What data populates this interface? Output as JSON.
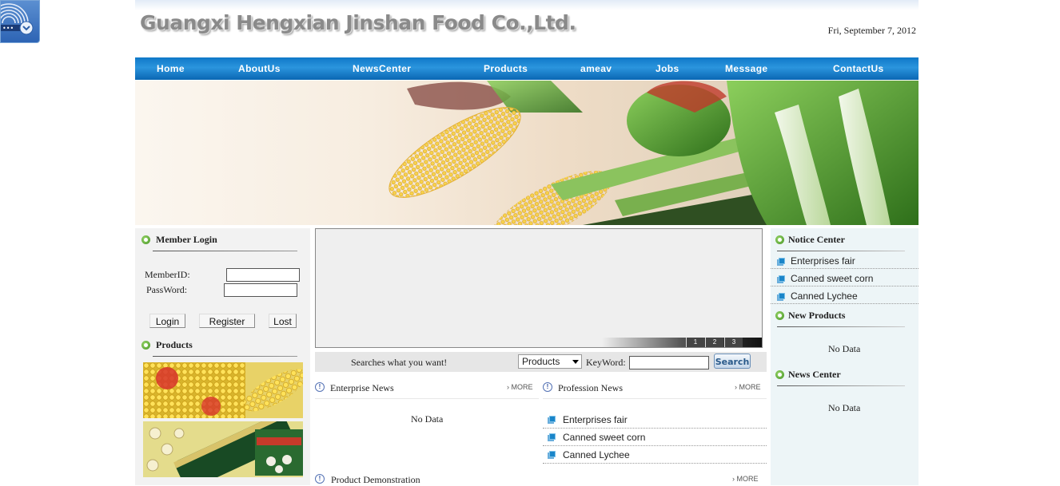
{
  "header": {
    "title": "Guangxi Hengxian Jinshan Food Co.,Ltd.",
    "date": "Fri, September 7, 2012"
  },
  "nav": [
    "Home",
    "AboutUs",
    "NewsCenter",
    "Products",
    "ameav",
    "Jobs",
    "Message",
    "ContactUs"
  ],
  "login": {
    "heading": "Member Login",
    "member_label": "MemberID:",
    "pass_label": "PassWord:",
    "member_value": "",
    "pass_value": "",
    "buttons": [
      "Login",
      "Register",
      "Lost"
    ]
  },
  "products_heading": "Products",
  "slider": {
    "pages": [
      "1",
      "2",
      "3"
    ]
  },
  "search": {
    "prompt": "Searches what you want!",
    "category": "Products",
    "keyword_label": "KeyWord:",
    "keyword_value": "",
    "button": "Search"
  },
  "enterprise_news": {
    "heading": "Enterprise News",
    "more": "MORE",
    "empty": "No Data"
  },
  "profession_news": {
    "heading": "Profession News",
    "more": "MORE",
    "items": [
      "Enterprises fair",
      "Canned sweet corn",
      "Canned Lychee"
    ]
  },
  "product_demo": {
    "heading": "Product Demonstration",
    "more": "MORE"
  },
  "notice_center": {
    "heading": "Notice Center",
    "items": [
      "Enterprises fair",
      "Canned sweet corn",
      "Canned Lychee"
    ]
  },
  "new_products": {
    "heading": "New Products",
    "empty": "No Data"
  },
  "news_center": {
    "heading": "News Center",
    "empty": "No Data"
  },
  "colors": {
    "nav_blue": "#1a80cc",
    "accent_green": "#3f8f1f",
    "bullet_blue": "#1a85c9"
  }
}
